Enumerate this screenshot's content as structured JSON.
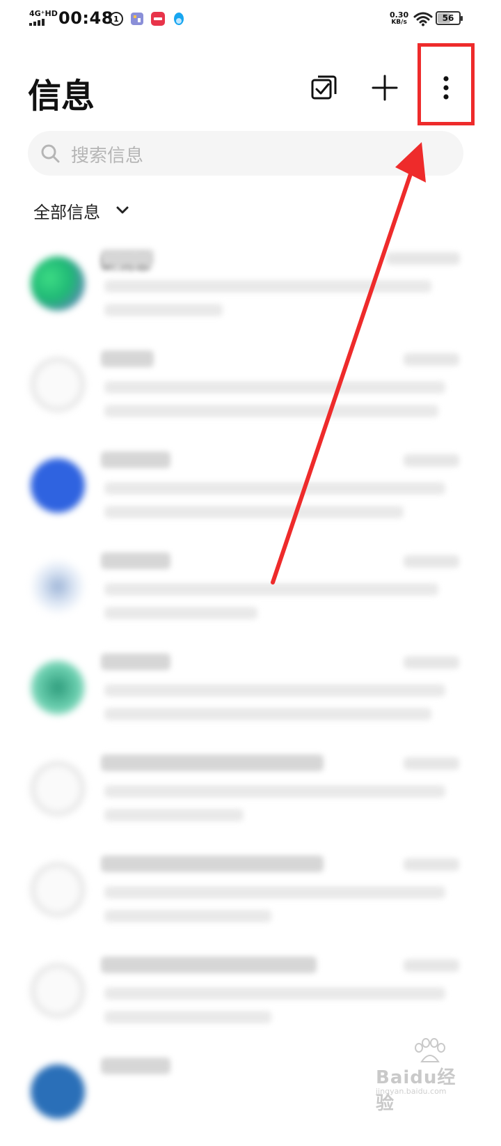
{
  "status_bar": {
    "network": "4G⁺HD",
    "time": "00:48",
    "speed_value": "0.30",
    "speed_unit": "KB/s",
    "battery": "56",
    "icons": [
      "data-saver-icon",
      "app-notification-icon",
      "red-app-icon",
      "qq-penguin-icon",
      "wifi-icon",
      "battery-icon"
    ]
  },
  "header": {
    "title": "信息",
    "actions": [
      "edit-select-icon",
      "plus-icon",
      "more-vertical-icon"
    ]
  },
  "search": {
    "placeholder": "搜索信息"
  },
  "filter": {
    "label": "全部信息"
  },
  "messages": [
    {
      "name": "新消息",
      "time": "",
      "preview": "",
      "avatar": "gradient-green"
    },
    {
      "name": "",
      "time": "",
      "preview": "",
      "avatar": "placeholder"
    },
    {
      "name": "",
      "time": "",
      "preview": "",
      "avatar": "blue"
    },
    {
      "name": "",
      "time": "",
      "preview": "",
      "avatar": "light-blue"
    },
    {
      "name": "",
      "time": "",
      "preview": "",
      "avatar": "teal"
    },
    {
      "name": "",
      "time": "",
      "preview": "",
      "avatar": "placeholder"
    },
    {
      "name": "",
      "time": "",
      "preview": "",
      "avatar": "placeholder"
    },
    {
      "name": "",
      "time": "",
      "preview": "",
      "avatar": "placeholder"
    },
    {
      "name": "",
      "time": "",
      "preview": "",
      "avatar": "dark-blue"
    }
  ],
  "annotation": {
    "color": "#ee2b2b",
    "target": "more-vertical-icon"
  },
  "watermark": {
    "main": "Baidu经验",
    "sub": "jingyan.baidu.com"
  }
}
